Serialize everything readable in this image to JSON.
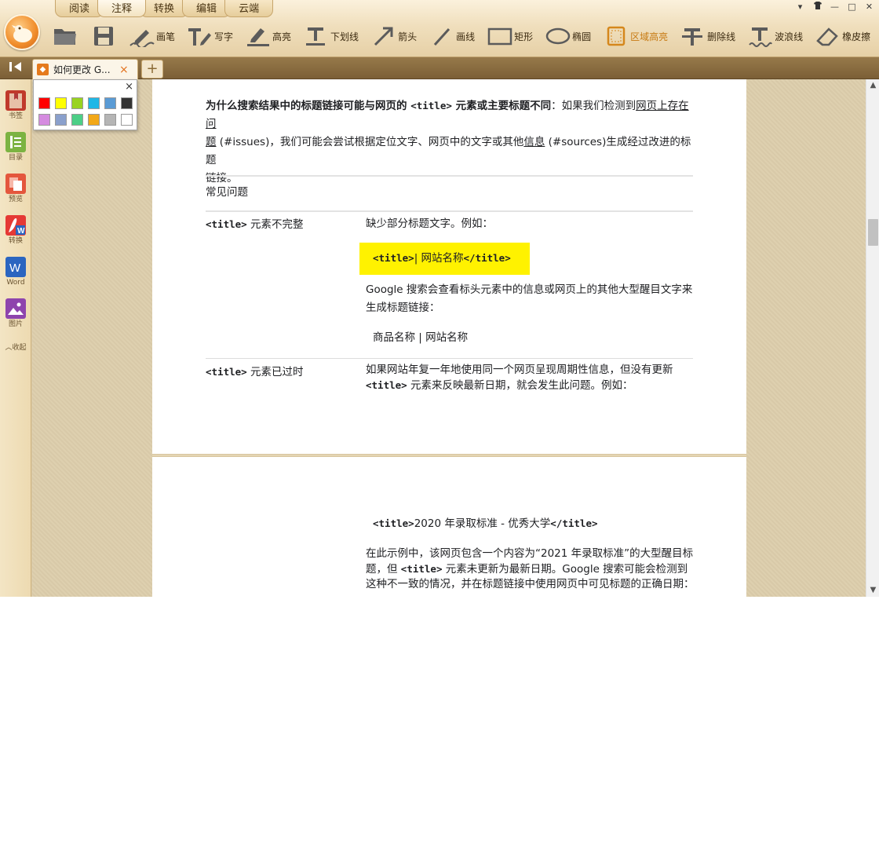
{
  "app": {
    "menu_tabs": [
      "阅读",
      "注释",
      "转换",
      "编辑",
      "云端"
    ],
    "active_menu": "注释",
    "window_controls": {
      "skin": "皮肤",
      "minimize": "最小化",
      "maximize": "最大化",
      "close": "关闭"
    }
  },
  "toolbar": {
    "open_icon": "folder-icon",
    "save_icon": "save-icon",
    "tools": [
      {
        "label": "画笔",
        "icon": "pen-icon"
      },
      {
        "label": "写字",
        "icon": "write-icon"
      },
      {
        "label": "高亮",
        "icon": "highlight-icon"
      },
      {
        "label": "下划线",
        "icon": "underline-icon"
      },
      {
        "label": "箭头",
        "icon": "arrow-icon"
      },
      {
        "label": "画线",
        "icon": "line-icon"
      },
      {
        "label": "矩形",
        "icon": "rectangle-icon"
      },
      {
        "label": "椭圆",
        "icon": "ellipse-icon"
      },
      {
        "label": "区域高亮",
        "icon": "area-highlight-icon",
        "active": true
      },
      {
        "label": "删除线",
        "icon": "strikethrough-icon"
      },
      {
        "label": "波浪线",
        "icon": "wavy-line-icon"
      },
      {
        "label": "橡皮擦",
        "icon": "eraser-icon"
      }
    ]
  },
  "tabs": {
    "doc_title": "如何更改 G...",
    "close": "×",
    "new_tab": "+"
  },
  "sidebar": {
    "items": [
      {
        "label": "书签",
        "color": "#c0392b"
      },
      {
        "label": "目录",
        "color": "#7cb342"
      },
      {
        "label": "预览",
        "color": "#e4573d"
      },
      {
        "label": "转换",
        "color": "#e53935"
      },
      {
        "label": "Word",
        "color": "#2b65c0"
      },
      {
        "label": "图片",
        "color": "#8e44ad"
      }
    ],
    "collapse_label": "收起"
  },
  "color_popup": {
    "close": "×",
    "swatches": [
      "#ff0000",
      "#ffff00",
      "#99d320",
      "#1fb7e6",
      "#5a9bd5",
      "#333333",
      "#d58be0",
      "#8aa0cc",
      "#4ccf87",
      "#f2a818",
      "#b5b5b5",
      "#ffffff"
    ],
    "selected": "#ffff00"
  },
  "document": {
    "p1": {
      "bold_a": "为什么搜索结果中的标题链接可能与网页的 ",
      "bold_code": "<title>",
      "bold_b": " 元素或主要标题不同",
      "text_a": "：如果我们检测到",
      "link_issue_1": "网页上存在问",
      "link_issue_2": "题",
      "text_b": " (#issues)，我们可能会尝试根据定位文字、网页中的文字或其他",
      "link_info": "信息",
      "text_c": " (#sources)生成经过改进的标题",
      "text_d": "链接。"
    },
    "faq_heading": "常见问题",
    "row1": {
      "left_code": "<title>",
      "left_text": " 元素不完整",
      "desc": "缺少部分标题文字。例如：",
      "example_open": "<title>",
      "example_text": "| 网站名称",
      "example_close": "</title>",
      "explain_1": "Google 搜索会查看标头元素中的信息或网页上的其他大型醒目文字来",
      "explain_2": "生成标题链接：",
      "result": "商品名称 | 网站名称"
    },
    "row2": {
      "left_code": "<title>",
      "left_text": " 元素已过时",
      "desc_1": "如果网站年复一年地使用同一个网页呈现周期性信息，但没有更新",
      "desc_code": "<title>",
      "desc_2": " 元素来反映最新日期，就会发生此问题。例如：",
      "example_open": "<title>",
      "example_text": "2020 年录取标准 - 优秀大学",
      "example_close": "</title>",
      "explain_1": "在此示例中，该网页包含一个内容为“2021 年录取标准”的大型醒目标",
      "explain_2a": "题，但 ",
      "explain_code": "<title>",
      "explain_2b": " 元素未更新为最新日期。Google 搜索可能会检测到",
      "explain_3": "这种不一致的情况，并在标题链接中使用网页中可见标题的正确日期："
    }
  }
}
